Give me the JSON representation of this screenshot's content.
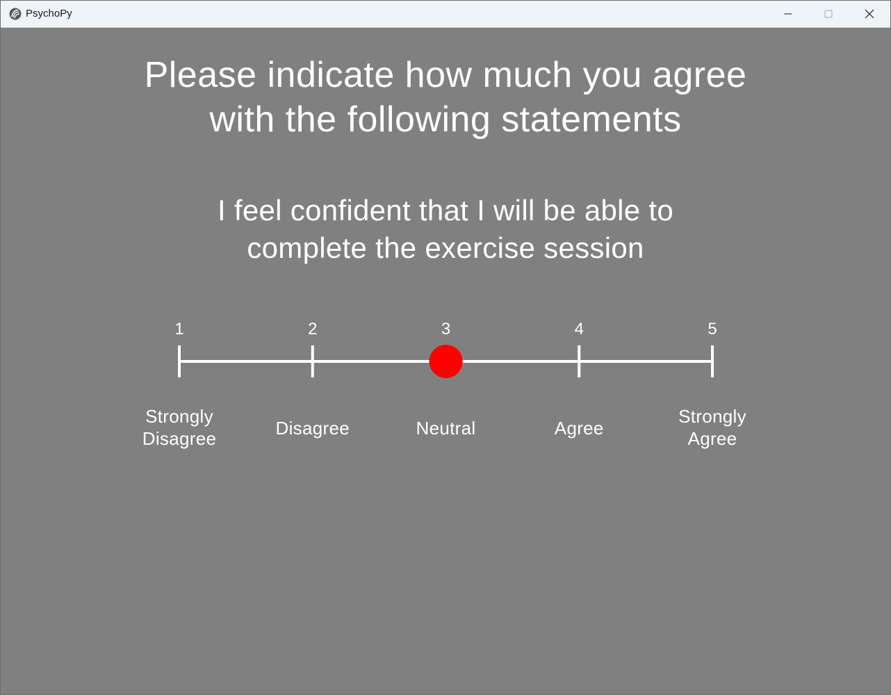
{
  "window": {
    "title": "PsychoPy",
    "icon": "psychopy-logo-icon",
    "background_color": "#808080"
  },
  "heading": {
    "line1": "Please indicate how much you agree",
    "line2": "with the following statements"
  },
  "statement": {
    "line1": "I feel confident that I will be able to",
    "line2": "complete the exercise session"
  },
  "rating_scale": {
    "ticks": [
      "1",
      "2",
      "3",
      "4",
      "5"
    ],
    "labels": [
      {
        "line1": "Strongly",
        "line2": "Disagree"
      },
      {
        "line1": "Disagree",
        "line2": ""
      },
      {
        "line1": "Neutral",
        "line2": ""
      },
      {
        "line1": "Agree",
        "line2": ""
      },
      {
        "line1": "Strongly",
        "line2": "Agree"
      }
    ],
    "selected_value": 3,
    "marker_color": "#ff0000",
    "line_color": "#ffffff"
  }
}
